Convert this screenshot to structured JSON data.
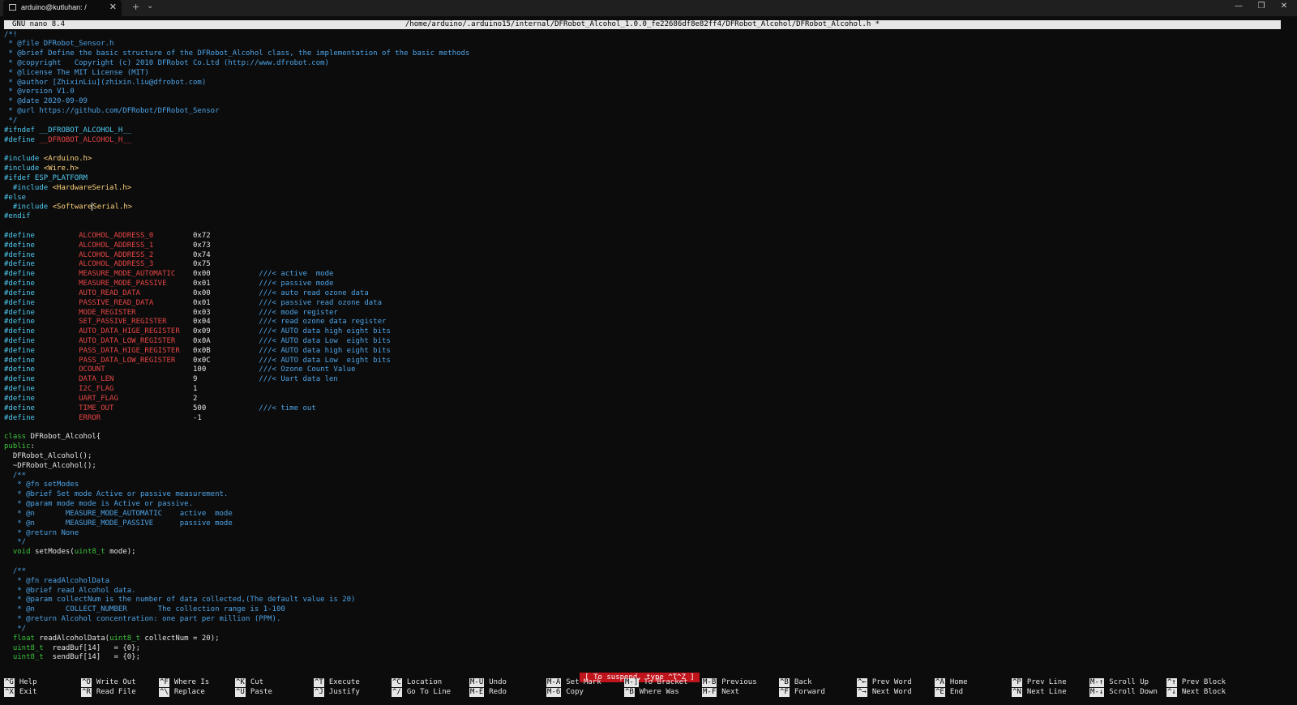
{
  "window": {
    "tab_title": "arduino@kutluhan: /",
    "tab_close": "✕",
    "new_tab": "+",
    "tab_menu": "⌄",
    "minimize": "—",
    "restore": "❐",
    "close": "✕"
  },
  "nano": {
    "version": "GNU nano 8.4",
    "filepath": "/home/arduino/.arduino15/internal/DFRobot_Alcohol_1.0.0_fe22686df8e82ff4/DFRobot_Alcohol/DFRobot_Alcohol.h *",
    "status_message": "[ To suspend, type ^T^Z ]"
  },
  "editor": {
    "lines": [
      [
        [
          "cm",
          "/*!"
        ]
      ],
      [
        [
          "cm",
          " * @file DFRobot_Sensor.h"
        ]
      ],
      [
        [
          "cm",
          " * @brief Define the basic structure of the DFRobot_Alcohol class, the implementation of the basic methods"
        ]
      ],
      [
        [
          "cm",
          " * @copyright   Copyright (c) 2010 DFRobot Co.Ltd (http://www.dfrobot.com)"
        ]
      ],
      [
        [
          "cm",
          " * @license The MIT License (MIT)"
        ]
      ],
      [
        [
          "cm",
          " * @author [ZhixinLiu](zhixin.liu@dfrobot.com)"
        ]
      ],
      [
        [
          "cm",
          " * @version V1.0"
        ]
      ],
      [
        [
          "cm",
          " * @date 2020-09-09"
        ]
      ],
      [
        [
          "cm",
          " * @url https://github.com/DFRobot/DFRobot_Sensor"
        ]
      ],
      [
        [
          "cm",
          " */"
        ]
      ],
      [
        [
          "pp",
          "#ifndef __DFROBOT_ALCOHOL_H__"
        ]
      ],
      [
        [
          "pp",
          "#define "
        ],
        [
          "dm",
          "__DFROBOT_ALCOHOL_H__"
        ]
      ],
      [],
      [
        [
          "pp",
          "#include "
        ],
        [
          "inc",
          "<Arduino.h>"
        ]
      ],
      [
        [
          "pp",
          "#include "
        ],
        [
          "inc",
          "<Wire.h>"
        ]
      ],
      [
        [
          "pp",
          "#ifdef ESP_PLATFORM"
        ]
      ],
      [
        [
          "pp",
          "  #include "
        ],
        [
          "inc",
          "<HardwareSerial.h>"
        ]
      ],
      [
        [
          "pp",
          "#else"
        ]
      ],
      [
        [
          "pp",
          "  #include "
        ],
        [
          "inc",
          "<Software"
        ],
        [
          "cursor",
          ""
        ],
        [
          "inc",
          "Serial.h>"
        ]
      ],
      [
        [
          "pp",
          "#endif"
        ]
      ],
      [],
      [
        [
          "pp",
          "#define          "
        ],
        [
          "dm",
          "ALCOHOL_ADDRESS_0         "
        ],
        [
          "lit",
          "0x72"
        ]
      ],
      [
        [
          "pp",
          "#define          "
        ],
        [
          "dm",
          "ALCOHOL_ADDRESS_1         "
        ],
        [
          "lit",
          "0x73"
        ]
      ],
      [
        [
          "pp",
          "#define          "
        ],
        [
          "dm",
          "ALCOHOL_ADDRESS_2         "
        ],
        [
          "lit",
          "0x74"
        ]
      ],
      [
        [
          "pp",
          "#define          "
        ],
        [
          "dm",
          "ALCOHOL_ADDRESS_3         "
        ],
        [
          "lit",
          "0x75"
        ]
      ],
      [
        [
          "pp",
          "#define          "
        ],
        [
          "dm",
          "MEASURE_MODE_AUTOMATIC    "
        ],
        [
          "lit",
          "0x00           "
        ],
        [
          "cm",
          "///< active  mode"
        ]
      ],
      [
        [
          "pp",
          "#define          "
        ],
        [
          "dm",
          "MEASURE_MODE_PASSIVE      "
        ],
        [
          "lit",
          "0x01           "
        ],
        [
          "cm",
          "///< passive mode"
        ]
      ],
      [
        [
          "pp",
          "#define          "
        ],
        [
          "dm",
          "AUTO_READ_DATA            "
        ],
        [
          "lit",
          "0x00           "
        ],
        [
          "cm",
          "///< auto read ozone data"
        ]
      ],
      [
        [
          "pp",
          "#define          "
        ],
        [
          "dm",
          "PASSIVE_READ_DATA         "
        ],
        [
          "lit",
          "0x01           "
        ],
        [
          "cm",
          "///< passive read ozone data"
        ]
      ],
      [
        [
          "pp",
          "#define          "
        ],
        [
          "dm",
          "MODE_REGISTER             "
        ],
        [
          "lit",
          "0x03           "
        ],
        [
          "cm",
          "///< mode register"
        ]
      ],
      [
        [
          "pp",
          "#define          "
        ],
        [
          "dm",
          "SET_PASSIVE_REGISTER      "
        ],
        [
          "lit",
          "0x04           "
        ],
        [
          "cm",
          "///< read ozone data register"
        ]
      ],
      [
        [
          "pp",
          "#define          "
        ],
        [
          "dm",
          "AUTO_DATA_HIGE_REGISTER   "
        ],
        [
          "lit",
          "0x09           "
        ],
        [
          "cm",
          "///< AUTO data high eight bits"
        ]
      ],
      [
        [
          "pp",
          "#define          "
        ],
        [
          "dm",
          "AUTO_DATA_LOW_REGISTER    "
        ],
        [
          "lit",
          "0x0A           "
        ],
        [
          "cm",
          "///< AUTO data Low  eight bits"
        ]
      ],
      [
        [
          "pp",
          "#define          "
        ],
        [
          "dm",
          "PASS_DATA_HIGE_REGISTER   "
        ],
        [
          "lit",
          "0x0B           "
        ],
        [
          "cm",
          "///< AUTO data high eight bits"
        ]
      ],
      [
        [
          "pp",
          "#define          "
        ],
        [
          "dm",
          "PASS_DATA_LOW_REGISTER    "
        ],
        [
          "lit",
          "0x0C           "
        ],
        [
          "cm",
          "///< AUTO data Low  eight bits"
        ]
      ],
      [
        [
          "pp",
          "#define          "
        ],
        [
          "dm",
          "OCOUNT                    "
        ],
        [
          "lit",
          "100            "
        ],
        [
          "cm",
          "///< Ozone Count Value"
        ]
      ],
      [
        [
          "pp",
          "#define          "
        ],
        [
          "dm",
          "DATA_LEN                  "
        ],
        [
          "lit",
          "9              "
        ],
        [
          "cm",
          "///< Uart data len"
        ]
      ],
      [
        [
          "pp",
          "#define          "
        ],
        [
          "dm",
          "I2C_FLAG                  "
        ],
        [
          "lit",
          "1"
        ]
      ],
      [
        [
          "pp",
          "#define          "
        ],
        [
          "dm",
          "UART_FLAG                 "
        ],
        [
          "lit",
          "2"
        ]
      ],
      [
        [
          "pp",
          "#define          "
        ],
        [
          "dm",
          "TIME_OUT                  "
        ],
        [
          "lit",
          "500            "
        ],
        [
          "cm",
          "///< time out"
        ]
      ],
      [
        [
          "pp",
          "#define          "
        ],
        [
          "dm",
          "ERROR                     "
        ],
        [
          "lit",
          "-1"
        ]
      ],
      [],
      [
        [
          "kw",
          "class "
        ],
        [
          "tx",
          "DFRobot_Alcohol{"
        ]
      ],
      [
        [
          "kw",
          "public"
        ],
        [
          "tx",
          ":"
        ]
      ],
      [
        [
          "tx",
          "  DFRobot_Alcohol();"
        ]
      ],
      [
        [
          "tx",
          "  ~DFRobot_Alcohol();"
        ]
      ],
      [
        [
          "cm",
          "  /**"
        ]
      ],
      [
        [
          "cm",
          "   * @fn setModes"
        ]
      ],
      [
        [
          "cm",
          "   * @brief Set mode Active or passive measurement."
        ]
      ],
      [
        [
          "cm",
          "   * @param mode mode is Active or passive."
        ]
      ],
      [
        [
          "cm",
          "   * @n       MEASURE_MODE_AUTOMATIC    active  mode"
        ]
      ],
      [
        [
          "cm",
          "   * @n       MEASURE_MODE_PASSIVE      passive mode"
        ]
      ],
      [
        [
          "cm",
          "   * @return None"
        ]
      ],
      [
        [
          "cm",
          "   */"
        ]
      ],
      [
        [
          "kw",
          "  void "
        ],
        [
          "tx",
          "setModes("
        ],
        [
          "kw",
          "uint8_t"
        ],
        [
          "tx",
          " mode);"
        ]
      ],
      [],
      [
        [
          "cm",
          "  /**"
        ]
      ],
      [
        [
          "cm",
          "   * @fn readAlcoholData"
        ]
      ],
      [
        [
          "cm",
          "   * @brief read Alcohol data."
        ]
      ],
      [
        [
          "cm",
          "   * @param collectNum is the number of data collected,(The default value is 20)"
        ]
      ],
      [
        [
          "cm",
          "   * @n       COLLECT_NUMBER       The collection range is 1-100"
        ]
      ],
      [
        [
          "cm",
          "   * @return Alcohol concentration: one part per million (PPM)."
        ]
      ],
      [
        [
          "cm",
          "   */"
        ]
      ],
      [
        [
          "kw",
          "  float "
        ],
        [
          "tx",
          "readAlcoholData("
        ],
        [
          "kw",
          "uint8_t"
        ],
        [
          "tx",
          " collectNum = 20);"
        ]
      ],
      [
        [
          "kw",
          "  uint8_t"
        ],
        [
          "tx",
          "  readBuf[14]   = {0};"
        ]
      ],
      [
        [
          "kw",
          "  uint8_t"
        ],
        [
          "tx",
          "  sendBuf[14]   = {0};"
        ]
      ]
    ]
  },
  "shortcuts": {
    "row1": [
      {
        "key": "^G",
        "label": "Help"
      },
      {
        "key": "^O",
        "label": "Write Out"
      },
      {
        "key": "^F",
        "label": "Where Is"
      },
      {
        "key": "^K",
        "label": "Cut"
      },
      {
        "key": "^T",
        "label": "Execute"
      },
      {
        "key": "^C",
        "label": "Location"
      },
      {
        "key": "M-U",
        "label": "Undo"
      },
      {
        "key": "M-A",
        "label": "Set Mark"
      },
      {
        "key": "M-]",
        "label": "To Bracket"
      },
      {
        "key": "M-B",
        "label": "Previous"
      },
      {
        "key": "^B",
        "label": "Back"
      },
      {
        "key": "^←",
        "label": "Prev Word"
      },
      {
        "key": "^A",
        "label": "Home"
      },
      {
        "key": "^P",
        "label": "Prev Line"
      },
      {
        "key": "M-↑",
        "label": "Scroll Up"
      },
      {
        "key": "^↑",
        "label": "Prev Block"
      }
    ],
    "row2": [
      {
        "key": "^X",
        "label": "Exit"
      },
      {
        "key": "^R",
        "label": "Read File"
      },
      {
        "key": "^\\",
        "label": "Replace"
      },
      {
        "key": "^U",
        "label": "Paste"
      },
      {
        "key": "^J",
        "label": "Justify"
      },
      {
        "key": "^/",
        "label": "Go To Line"
      },
      {
        "key": "M-E",
        "label": "Redo"
      },
      {
        "key": "M-6",
        "label": "Copy"
      },
      {
        "key": "^B",
        "label": "Where Was"
      },
      {
        "key": "M-F",
        "label": "Next"
      },
      {
        "key": "^F",
        "label": "Forward"
      },
      {
        "key": "^→",
        "label": "Next Word"
      },
      {
        "key": "^E",
        "label": "End"
      },
      {
        "key": "^N",
        "label": "Next Line"
      },
      {
        "key": "M-↓",
        "label": "Scroll Down"
      },
      {
        "key": "^↓",
        "label": "Next Block"
      }
    ]
  }
}
